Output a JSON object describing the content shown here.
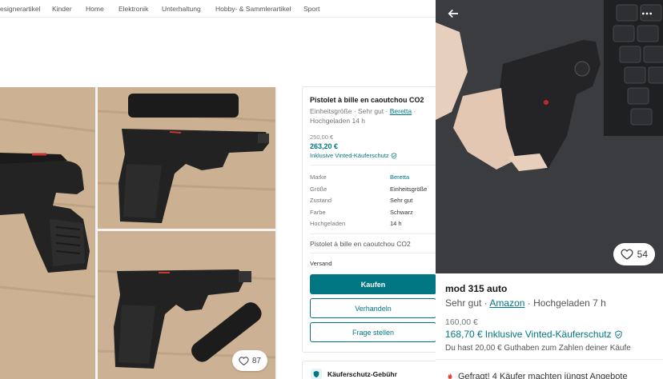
{
  "categories": [
    "esignerartikel",
    "Kinder",
    "Home",
    "Elektronik",
    "Unterhaltung",
    "Hobby- & Sammlerartikel",
    "Sport"
  ],
  "listing": {
    "title": "Pistolet à bille en caoutchou CO2",
    "size": "Einheitsgröße",
    "condition": "Sehr gut",
    "brand": "Beretta",
    "uploaded": "Hochgeladen 14 h",
    "price_old": "250,00 €",
    "price": "263,20 €",
    "buyer_protection": "Inklusive Vinted-Käuferschutz",
    "details": [
      {
        "key": "Marke",
        "value": "Beretta"
      },
      {
        "key": "Größe",
        "value": "Einheitsgröße"
      },
      {
        "key": "Zustand",
        "value": "Sehr gut"
      },
      {
        "key": "Farbe",
        "value": "Schwarz"
      },
      {
        "key": "Hochgeladen",
        "value": "14 h"
      }
    ],
    "description": "Pistolet à bille en caoutchou CO2",
    "shipping_label": "Versand",
    "buy_label": "Kaufen",
    "offer_label": "Verhandeln",
    "ask_label": "Frage stellen",
    "favourites": "87",
    "fee_label": "Käuferschutz-Gebühr"
  },
  "mobile": {
    "favourites": "54",
    "title": "mod 315 auto",
    "condition": "Sehr gut",
    "brand": "Amazon",
    "uploaded": "Hochgeladen 7 h",
    "price_old": "160,00 €",
    "price": "168,70 €",
    "buyer_protection": "Inklusive Vinted-Käuferschutz",
    "credit_note": "Du hast 20,00 € Guthaben zum Zahlen deiner Käufe",
    "bottom_note": "Gefragt! 4 Käufer machten jüngst Angebote"
  },
  "colors": {
    "accent": "#007782",
    "photo_wood": "#c9ad90",
    "photo_dark": "#3a3b3e"
  }
}
